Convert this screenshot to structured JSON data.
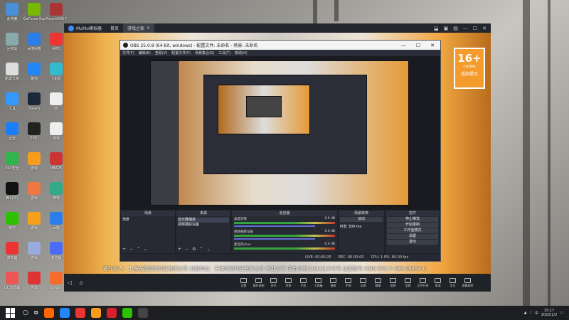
{
  "desktop": {
    "icons": [
      {
        "label": "此电脑",
        "color": "#4a90d9"
      },
      {
        "label": "GeForce Experience",
        "color": "#76b900"
      },
      {
        "label": "MorphVOX Pro",
        "color": "#a33"
      },
      {
        "label": "回收站",
        "color": "#8aa"
      },
      {
        "label": "百度网盘",
        "color": "#2b7de9"
      },
      {
        "label": "AMD",
        "color": "#e33"
      },
      {
        "label": "新建文档",
        "color": "#ddd"
      },
      {
        "label": "酷狗",
        "color": "#2386f7"
      },
      {
        "label": "七彩虹",
        "color": "#3bc"
      },
      {
        "label": "工具",
        "color": "#39f"
      },
      {
        "label": "Steam",
        "color": "#1b2838"
      },
      {
        "label": "UU",
        "color": "#eee"
      },
      {
        "label": "迅雷",
        "color": "#1b7df7"
      },
      {
        "label": "EPIC",
        "color": "#222"
      },
      {
        "label": "游戏",
        "color": "#eee"
      },
      {
        "label": "360安全",
        "color": "#2fb54a"
      },
      {
        "label": "游戏",
        "color": "#f79c1c"
      },
      {
        "label": "NBA2K",
        "color": "#c33"
      },
      {
        "label": "腾讯QQ",
        "color": "#111"
      },
      {
        "label": "游戏",
        "color": "#e74"
      },
      {
        "label": "微软",
        "color": "#3a8"
      },
      {
        "label": "微信",
        "color": "#2dc100"
      },
      {
        "label": "游戏",
        "color": "#f7a01c"
      },
      {
        "label": "百度",
        "color": "#2b7de9"
      },
      {
        "label": "浏览器",
        "color": "#e33"
      },
      {
        "label": "游戏",
        "color": "#9ad"
      },
      {
        "label": "浏览器",
        "color": "#4a6cf7"
      },
      {
        "label": "UC浏览器",
        "color": "#e55"
      },
      {
        "label": "游戏",
        "color": "#d33"
      },
      {
        "label": "Origin",
        "color": "#f56c2d"
      }
    ]
  },
  "mumu": {
    "tabs": [
      {
        "label": "MuMu模拟器"
      },
      {
        "label": "首页"
      },
      {
        "label": "游戏之家"
      }
    ],
    "window_controls": [
      "⬓",
      "▣",
      "▤",
      "—",
      "☐",
      "✕"
    ],
    "age_badge": {
      "number": "16+",
      "org": "CADPA",
      "tip": "适龄提示"
    },
    "copyright": "著作权人：上海光趣网络科技有限公司 出版单位：天津网络科技有限公司 审批文号 国新出审[2021]1375号 出版物号 ISBN 978-7-498-09353-0",
    "bottom_tools": [
      {
        "label": "设置"
      },
      {
        "label": "操作录制"
      },
      {
        "label": "多开"
      },
      {
        "label": "共享"
      },
      {
        "label": "手机"
      },
      {
        "label": "工具箱"
      },
      {
        "label": "键鼠"
      },
      {
        "label": "手柄"
      },
      {
        "label": "全屏"
      },
      {
        "label": "截图"
      },
      {
        "label": "录屏"
      },
      {
        "label": "全屏"
      },
      {
        "label": "文件共享"
      },
      {
        "label": "电池"
      },
      {
        "label": "定位"
      },
      {
        "label": "屏幕旋转"
      }
    ],
    "nav": [
      "◁",
      "⌂"
    ]
  },
  "obs": {
    "title": "OBS 25.0.8 (64-bit, windows) - 配置文件: 未命名 - 场景: 未命名",
    "window_controls": [
      "—",
      "☐",
      "✕"
    ],
    "menu": [
      "文件(F)",
      "编辑(E)",
      "查看(V)",
      "配置文件(P)",
      "场景集合(S)",
      "工具(T)",
      "帮助(H)"
    ],
    "scenes": {
      "title": "场景",
      "items": [
        "场景"
      ]
    },
    "sources": {
      "title": "来源",
      "items": [
        "显示器捕获",
        "视频捕获设备"
      ]
    },
    "mixer": {
      "title": "混音器",
      "channels": [
        {
          "name": "桌面音频",
          "db": "0.0 dB"
        },
        {
          "name": "视频捕获设备",
          "db": "0.0 dB"
        },
        {
          "name": "麦克风/Aux",
          "db": "0.0 dB"
        }
      ]
    },
    "transitions": {
      "title": "场景转换",
      "type": "淡出",
      "duration_label": "时长",
      "duration": "300 ms"
    },
    "controls": {
      "title": "控件",
      "buttons": [
        "停止推流",
        "开始录制",
        "工作室模式",
        "设置",
        "退出"
      ]
    },
    "status": {
      "live": "LIVE: 00:00:20",
      "rec": "REC: 00:00:00",
      "cpu": "CPU: 1.9%, 60.00 fps"
    }
  },
  "taskbar": {
    "apps": [
      {
        "color": "#f60"
      },
      {
        "color": "#2386f7"
      },
      {
        "color": "#e33"
      },
      {
        "color": "#f79c1c"
      },
      {
        "color": "#d9202a"
      },
      {
        "color": "#2dc100"
      },
      {
        "color": "#444"
      }
    ],
    "tray": {
      "lang": "中",
      "time": "15:17",
      "date": "2022/1/2"
    }
  }
}
